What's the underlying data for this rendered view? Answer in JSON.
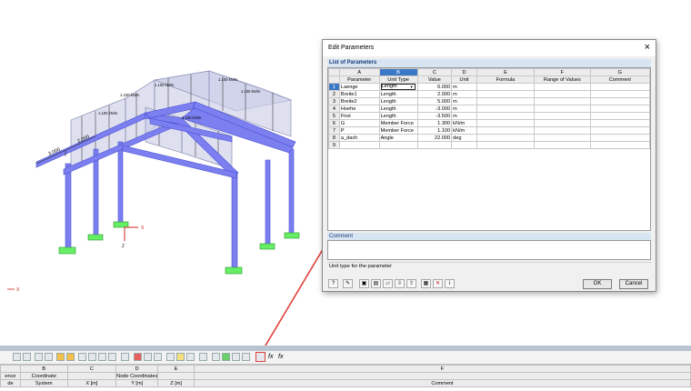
{
  "model": {
    "dimension_labels": [
      "3.000",
      "2.000"
    ],
    "load_labels": [
      "1.100 kN/m",
      "1.100 kN/m",
      "1.100 kN/m",
      "1.100 kN/m",
      "1.100 kN/m",
      "1.100 kN/m"
    ],
    "axis_x": "X",
    "axis_z": "Z",
    "small_axis_x": "X"
  },
  "dialog": {
    "title": "Edit Parameters",
    "list_header": "List of Parameters",
    "columns": {
      "letters": [
        "A",
        "B",
        "C",
        "D",
        "E",
        "F",
        "G"
      ],
      "names": [
        "Parameter",
        "Unit Type",
        "Value",
        "Unit",
        "Formula",
        "Range of Values",
        "Comment"
      ]
    },
    "rows": [
      {
        "no": "1",
        "parameter": "Laenge",
        "unit_type": "Length",
        "value": "6.000",
        "unit": "m"
      },
      {
        "no": "2",
        "parameter": "Breite1",
        "unit_type": "Length",
        "value": "2.000",
        "unit": "m"
      },
      {
        "no": "3",
        "parameter": "Breite2",
        "unit_type": "Length",
        "value": "5.000",
        "unit": "m"
      },
      {
        "no": "4",
        "parameter": "Hoehe",
        "unit_type": "Length",
        "value": "-3.000",
        "unit": "m"
      },
      {
        "no": "5",
        "parameter": "First",
        "unit_type": "Length",
        "value": "-3.500",
        "unit": "m"
      },
      {
        "no": "6",
        "parameter": "G",
        "unit_type": "Member Force",
        "value": "1.300",
        "unit": "kN/m"
      },
      {
        "no": "7",
        "parameter": "P",
        "unit_type": "Member Force",
        "value": "1.100",
        "unit": "kN/m"
      },
      {
        "no": "8",
        "parameter": "a_dach",
        "unit_type": "Angle",
        "value": "22.000",
        "unit": "deg"
      },
      {
        "no": "9",
        "parameter": "",
        "unit_type": "",
        "value": "",
        "unit": ""
      }
    ],
    "comment_label": "Comment",
    "status_text": "Unit type for the parameter",
    "ok_label": "OK",
    "cancel_label": "Cancel"
  },
  "bottom_table": {
    "letters": [
      "",
      "B",
      "C",
      "D",
      "E",
      "F"
    ],
    "group_row": [
      "ence",
      "Coordinate",
      "",
      "Node Coordinates",
      "",
      ""
    ],
    "header_row": [
      "de",
      "System",
      "X [m]",
      "Y [m]",
      "Z [m]",
      "Comment"
    ]
  },
  "toolbar": {
    "fx_label": "fx",
    "fx2_label": "fx"
  },
  "colors": {
    "member": "#7b7ff0",
    "member_dark": "#4a4fd0",
    "support": "#66ee66",
    "load_fill": "#c8cbe6",
    "arrow": "#e0403a",
    "selection": "#3c78c8"
  }
}
